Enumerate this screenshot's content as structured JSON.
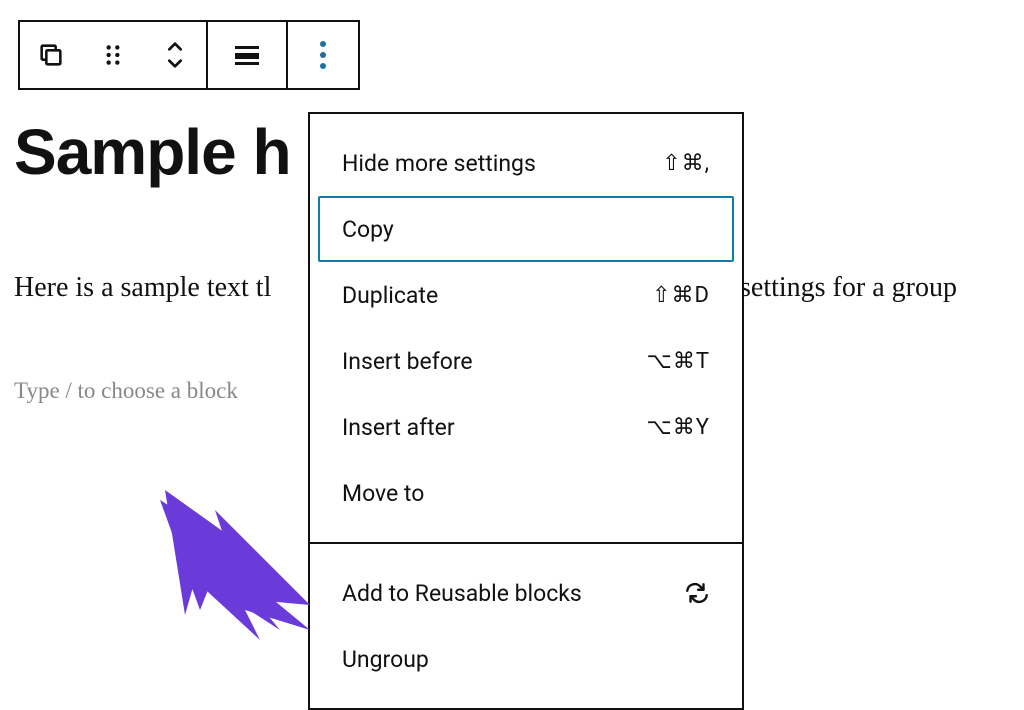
{
  "toolbar": {
    "icons": {
      "copy_block": "copy-overlap-icon",
      "drag_handle": "drag-handle-icon",
      "move_up_down": "move-arrows-icon",
      "align": "align-icon",
      "more": "more-vertical-icon"
    }
  },
  "heading": "Sample h",
  "paragraph_left": "Here is a sample text tl",
  "paragraph_right": " settings for a group",
  "placeholder": "Type / to choose a block",
  "menu": {
    "section1": [
      {
        "label": "Hide more settings",
        "shortcut": "⇧⌘,"
      },
      {
        "label": "Copy",
        "shortcut": "",
        "focused": true
      },
      {
        "label": "Duplicate",
        "shortcut": "⇧⌘D"
      },
      {
        "label": "Insert before",
        "shortcut": "⌥⌘T"
      },
      {
        "label": "Insert after",
        "shortcut": "⌥⌘Y"
      },
      {
        "label": "Move to",
        "shortcut": ""
      }
    ],
    "section2": [
      {
        "label": "Add to Reusable blocks",
        "icon": "reusable-icon"
      },
      {
        "label": "Ungroup"
      }
    ]
  },
  "colors": {
    "accent": "#0f7ea8",
    "arrow": "#6b3bd9",
    "menu_more_dots": "#1a6fa3"
  }
}
